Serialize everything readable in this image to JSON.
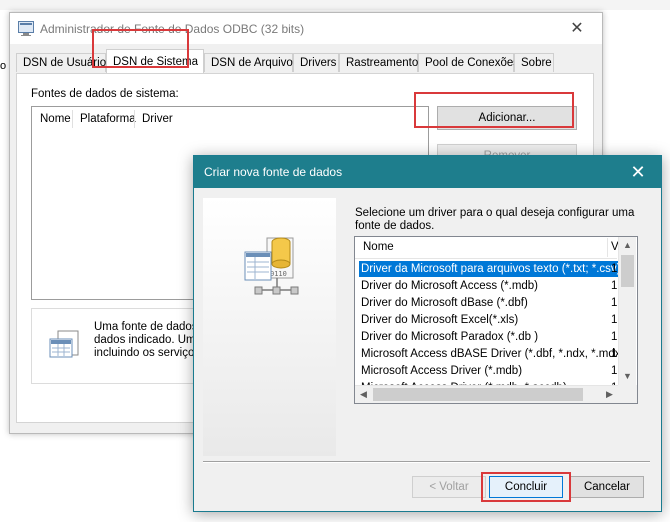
{
  "behind": {
    "left_fragment": "o"
  },
  "odbc_window": {
    "title": "Administrador de Fonte de Dados ODBC (32 bits)",
    "close_glyph": "✕",
    "tabs": [
      "DSN de Usuário",
      "DSN de Sistema",
      "DSN de Arquivo",
      "Drivers",
      "Rastreamento",
      "Pool de Conexões",
      "Sobre"
    ],
    "active_tab": "DSN de Sistema",
    "list_label": "Fontes de dados de sistema:",
    "columns": [
      "Nome",
      "Plataforma",
      "Driver"
    ],
    "buttons": {
      "add": "Adicionar...",
      "remove": "Remover"
    },
    "info_text": [
      "Uma fonte de dados de",
      "dados indicado. Uma f",
      "incluindo os serviços N"
    ]
  },
  "modal": {
    "title": "Criar nova fonte de dados",
    "close_glyph": "✕",
    "instruction": "Selecione um driver para o qual deseja configurar uma fonte de dados.",
    "list_header": {
      "name": "Nome",
      "version": "V"
    },
    "drivers": [
      {
        "name": "Driver da Microsoft para arquivos texto (*.txt; *.csv)",
        "version": "1",
        "selected": true
      },
      {
        "name": "Driver do Microsoft Access (*.mdb)",
        "version": "1"
      },
      {
        "name": "Driver do Microsoft dBase (*.dbf)",
        "version": "1"
      },
      {
        "name": "Driver do Microsoft Excel(*.xls)",
        "version": "1"
      },
      {
        "name": "Driver do Microsoft Paradox (*.db )",
        "version": "1"
      },
      {
        "name": "Microsoft Access dBASE Driver (*.dbf, *.ndx, *.mdx)",
        "version": "1"
      },
      {
        "name": "Microsoft Access Driver (*.mdb)",
        "version": "1"
      },
      {
        "name": "Microsoft Access Driver (*.mdb, *.accdb)",
        "version": "1"
      }
    ],
    "buttons": {
      "back": "< Voltar",
      "finish": "Concluir",
      "cancel": "Cancelar"
    }
  },
  "colors": {
    "modal_titlebar": "#1e7e8d",
    "selection": "#0078d7",
    "highlight_box": "#d9393b"
  },
  "icons": {
    "odbc_title": "odbc-window-icon",
    "info": "data-source-info-icon",
    "wizard": "database-wizard-art"
  }
}
